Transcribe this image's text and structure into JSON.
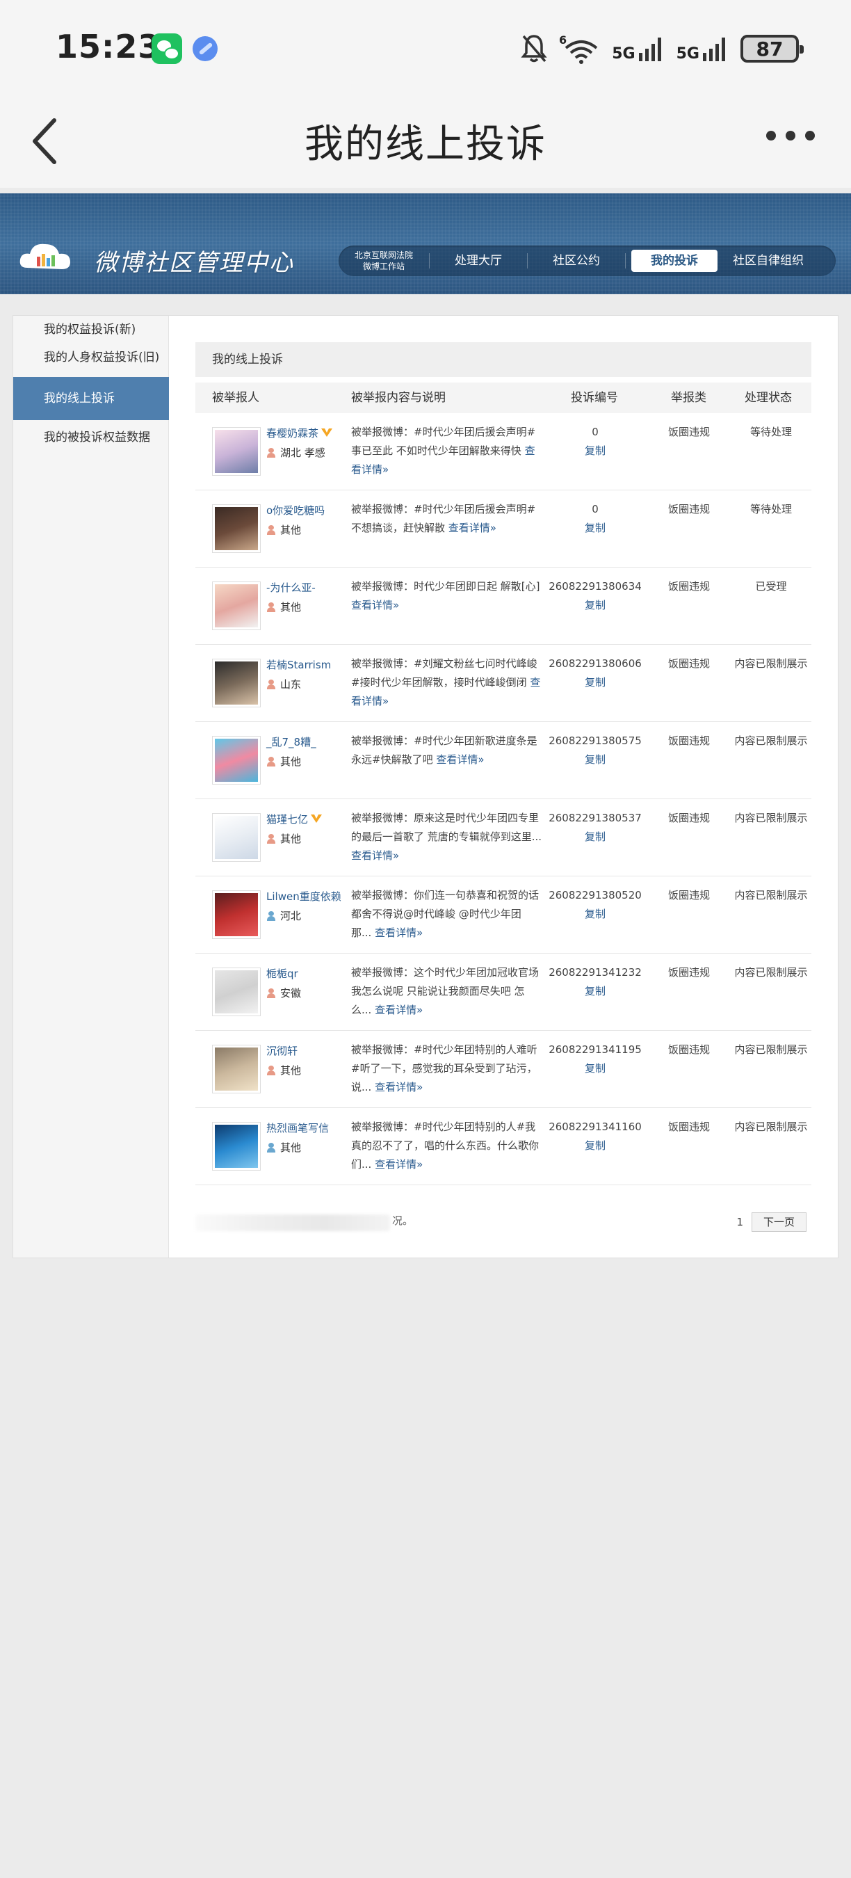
{
  "status_bar": {
    "time": "15:23",
    "battery": "87",
    "net1": "5G",
    "net2": "5G"
  },
  "titlebar": {
    "title": "我的线上投诉"
  },
  "banner": {
    "logo_text": "微博社区管理中心",
    "nav": [
      {
        "label_line1": "北京互联网法院",
        "label_line2": "微博工作站"
      },
      {
        "label": "处理大厅"
      },
      {
        "label": "社区公约"
      },
      {
        "label": "我的投诉"
      },
      {
        "label": "社区自律组织"
      }
    ]
  },
  "sidebar": {
    "items": [
      "我的权益投诉(新)",
      "我的人身权益投诉(旧)",
      "我的线上投诉",
      "我的被投诉权益数据"
    ]
  },
  "content": {
    "title": "我的线上投诉",
    "headers": [
      "被举报人",
      "被举报内容与说明",
      "投诉编号",
      "举报类",
      "处理状态"
    ],
    "copy_label": "复制",
    "detail_label": "查看详情»",
    "rows": [
      {
        "name": "春樱奶霖茶",
        "location": "湖北 孝感",
        "desc": "被举报微博：#时代少年团后援会声明#事已至此 不如时代少年团解散来得快",
        "number": "0",
        "type": "饭圈违规",
        "status": "等待处理"
      },
      {
        "name": "o你爱吃糖吗",
        "location": "其他",
        "desc": "被举报微博：#时代少年团后援会声明#不想搞谈，赶快解散",
        "number": "0",
        "type": "饭圈违规",
        "status": "等待处理"
      },
      {
        "name": "-为什么亚-",
        "location": "其他",
        "desc": "被举报微博：时代少年团即日起 解散[心]",
        "number": "26082291380634",
        "type": "饭圈违规",
        "status": "已受理"
      },
      {
        "name": "若楠Starrism",
        "location": "山东",
        "desc": "被举报微博：#刘耀文粉丝七问时代峰峻#接时代少年团解散，接时代峰峻倒闭",
        "number": "26082291380606",
        "type": "饭圈违规",
        "status": "内容已限制展示"
      },
      {
        "name": "_乱7_8糟_",
        "location": "其他",
        "desc": "被举报微博：#时代少年团新歌进度条是永远#快解散了吧",
        "number": "26082291380575",
        "type": "饭圈违规",
        "status": "内容已限制展示"
      },
      {
        "name": "猫瑾七亿",
        "location": "其他",
        "desc": "被举报微博：原来这是时代少年团四专里的最后一首歌了 荒唐的专辑就停到这里...",
        "number": "26082291380537",
        "type": "饭圈违规",
        "status": "内容已限制展示"
      },
      {
        "name": "Lilwen重度依赖",
        "location": "河北",
        "desc": "被举报微博：你们连一句恭喜和祝贺的话都舍不得说@时代峰峻 @时代少年团 那...",
        "number": "26082291380520",
        "type": "饭圈违规",
        "status": "内容已限制展示"
      },
      {
        "name": "栀栀qr",
        "location": "安徽",
        "desc": "被举报微博：这个时代少年团加冠收官场我怎么说呢 只能说让我颜面尽失吧 怎么...",
        "number": "26082291341232",
        "type": "饭圈违规",
        "status": "内容已限制展示"
      },
      {
        "name": "沉彻轩",
        "location": "其他",
        "desc": "被举报微博：#时代少年团特别的人难听#听了一下，感觉我的耳朵受到了玷污，说...",
        "number": "26082291341195",
        "type": "饭圈违规",
        "status": "内容已限制展示"
      },
      {
        "name": "热烈画笔写信",
        "location": "其他",
        "desc": "被举报微博：#时代少年团特别的人#我真的忍不了了，唱的什么东西。什么歌你们...",
        "number": "26082291341160",
        "type": "饭圈违规",
        "status": "内容已限制展示"
      }
    ]
  },
  "footer": {
    "tail_text": "况。",
    "page": "1",
    "next_label": "下一页"
  },
  "colors": {
    "banner": "#2d5a86",
    "link": "#2a5b8e",
    "sidebar_active": "#4f7fae"
  }
}
